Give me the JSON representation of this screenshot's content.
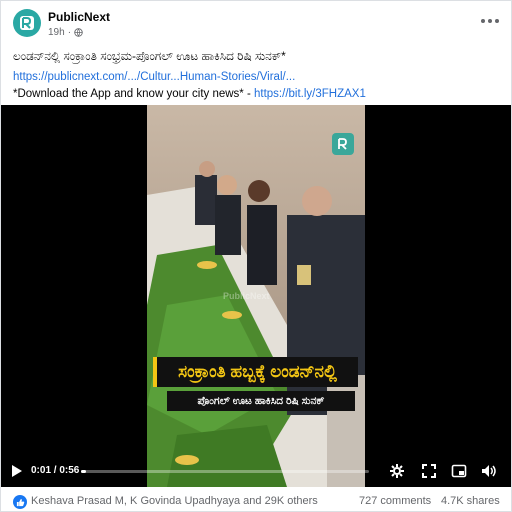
{
  "post": {
    "page_name": "PublicNext",
    "time_ago": "19h",
    "separator": "·",
    "headline": "ಲಂಡನ್‌ನಲ್ಲಿ ಸಂಕ್ರಾಂತಿ ಸಂಭ್ರಮ-ಪೊಂಗಲ್ ಊಟ ಹಾಕಿಸಿದ ರಿಷಿ ಸುನಕ್*",
    "link_text": "https://publicnext.com/.../Cultur...Human-Stories/Viral/...",
    "download_prefix": "*Download the App and know your city news* - ",
    "download_link": "https://bit.ly/3FHZAX1"
  },
  "video": {
    "watermark": "PublicNext",
    "caption_line1": "ಸಂಕ್ರಾಂತಿ ಹಬ್ಬಕ್ಕೆ ಲಂಡನ್‌ನಲ್ಲಿ",
    "caption_line2": "ಪೊಂಗಲ್ ಊಟ ಹಾಕಿಸಿದ ರಿಷಿ ಸುನಕ್",
    "time": "0:01 / 0:56",
    "progress": 0.018
  },
  "footer": {
    "reactors": "Keshava Prasad M, K Govinda Upadhyaya and 29K others",
    "comments": "727 comments",
    "shares": "4.7K shares"
  },
  "colors": {
    "brand": "#2aa8a4",
    "link": "#216fdb",
    "caption_yellow": "#f3c614",
    "like_blue": "#1877f2"
  },
  "icons": [
    "globe-icon",
    "more-icon",
    "play-icon",
    "settings-icon",
    "fullscreen-icon",
    "pip-icon",
    "volume-icon",
    "like-icon"
  ]
}
